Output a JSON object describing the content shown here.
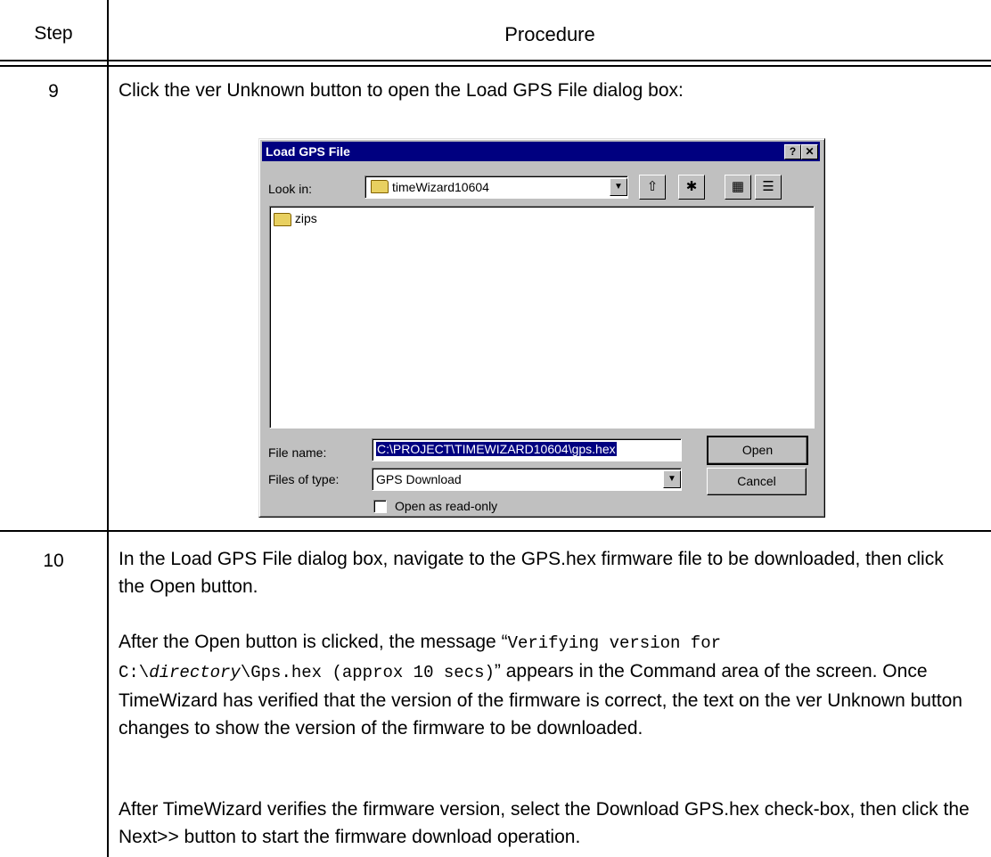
{
  "table": {
    "header_step": "Step",
    "header_procedure": "Procedure",
    "rows": [
      {
        "step": "9",
        "text": "Click the ver Unknown button to open the Load GPS File dialog box:"
      },
      {
        "step": "10",
        "p1": "In the Load GPS File dialog box, navigate to the GPS.hex firmware file to be downloaded, then click the Open button.",
        "p2_before": "After the Open button is clicked, the message ",
        "p2_open_quote": "“",
        "p2_mono1": "Verifying version for",
        "p2_mono2a": "C:\\",
        "p2_mono2b": "directory",
        "p2_mono2c": "\\Gps.hex (approx 10 secs)",
        "p2_close_quote": "”",
        "p2_after": " appears in the Command area of the screen. Once TimeWizard has verified that the version of the firmware is correct, the text on the ver Unknown button changes to show the version of the firmware to be downloaded.",
        "p3": "After TimeWizard verifies the firmware version, select the Download GPS.hex check-box, then click the Next>> button to start the firmware download operation."
      }
    ]
  },
  "dialog": {
    "title": "Load GPS File",
    "help_btn": "?",
    "close_btn": "✕",
    "look_in_label": "Look in:",
    "look_in_value": "timeWizard10604",
    "files": [
      "zips"
    ],
    "file_name_label": "File name:",
    "file_name_value": "C:\\PROJECT\\TIMEWIZARD10604\\gps.hex",
    "files_of_type_label": "Files of type:",
    "files_of_type_value": "GPS Download",
    "open_button": "Open",
    "cancel_button": "Cancel",
    "readonly_label": "Open as read-only",
    "readonly_checked": false
  }
}
